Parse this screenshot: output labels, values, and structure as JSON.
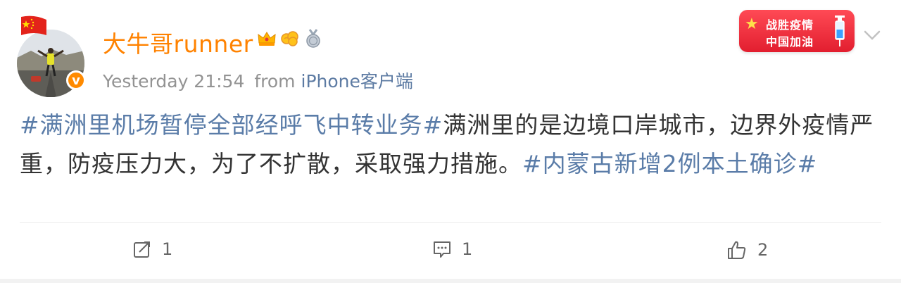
{
  "post": {
    "author": {
      "name": "大牛哥runner",
      "verified_mark": "v"
    },
    "meta": {
      "time": "Yesterday 21:54",
      "from_label": "from",
      "source": "iPhone客户端"
    },
    "promo": {
      "line1": "战胜疫情",
      "line2": "中国加油"
    },
    "content": {
      "tag1": "#满洲里机场暂停全部经呼飞中转业务#",
      "text": "满洲里的是边境口岸城市，边界外疫情严重，防疫压力大，为了不扩散，采取强力措施。",
      "tag2": "#内蒙古新增2例本土确诊#"
    },
    "actions": {
      "repost_count": "1",
      "comment_count": "1",
      "like_count": "2"
    }
  },
  "colors": {
    "username": "#ff8200",
    "hashtag": "#5a7ca8",
    "text": "#333333",
    "meta": "#939393"
  },
  "icons": [
    "flag-icon",
    "verified-icon",
    "crown-badge-icon",
    "cloud-badge-icon",
    "medal-badge-icon",
    "chevron-down-icon",
    "repost-icon",
    "comment-icon",
    "like-icon"
  ]
}
